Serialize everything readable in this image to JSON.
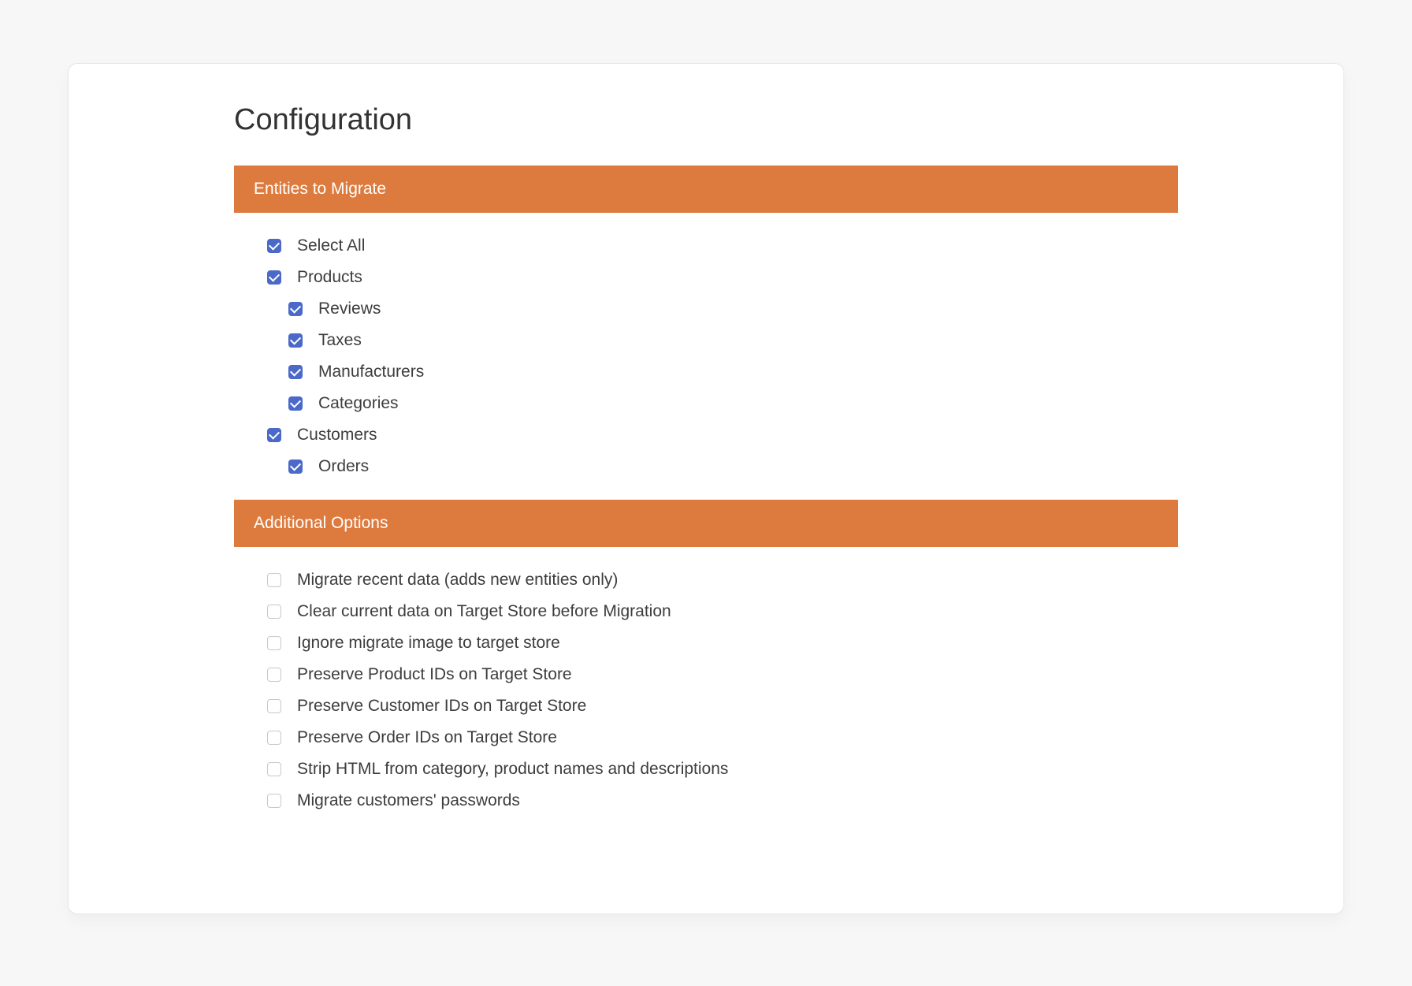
{
  "title": "Configuration",
  "sections": {
    "entities": {
      "header": "Entities to Migrate",
      "items": [
        {
          "label": "Select All",
          "checked": true,
          "indent": 0
        },
        {
          "label": "Products",
          "checked": true,
          "indent": 0
        },
        {
          "label": "Reviews",
          "checked": true,
          "indent": 1
        },
        {
          "label": "Taxes",
          "checked": true,
          "indent": 1
        },
        {
          "label": "Manufacturers",
          "checked": true,
          "indent": 1
        },
        {
          "label": "Categories",
          "checked": true,
          "indent": 1
        },
        {
          "label": "Customers",
          "checked": true,
          "indent": 0
        },
        {
          "label": "Orders",
          "checked": true,
          "indent": 1
        }
      ]
    },
    "options": {
      "header": "Additional Options",
      "items": [
        {
          "label": "Migrate recent data (adds new entities only)",
          "checked": false,
          "indent": 0
        },
        {
          "label": "Clear current data on Target Store before Migration",
          "checked": false,
          "indent": 0
        },
        {
          "label": "Ignore migrate image to target store",
          "checked": false,
          "indent": 0
        },
        {
          "label": "Preserve Product IDs on Target Store",
          "checked": false,
          "indent": 0
        },
        {
          "label": "Preserve Customer IDs on Target Store",
          "checked": false,
          "indent": 0
        },
        {
          "label": "Preserve Order IDs on Target Store",
          "checked": false,
          "indent": 0
        },
        {
          "label": "Strip HTML from category, product names and descriptions",
          "checked": false,
          "indent": 0
        },
        {
          "label": "Migrate customers' passwords",
          "checked": false,
          "indent": 0
        }
      ]
    }
  }
}
